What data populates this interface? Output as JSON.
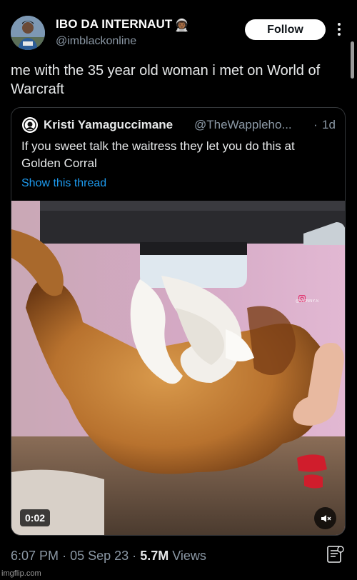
{
  "author": {
    "display_name": "IBO DA INTERNAUT",
    "badge_emoji": "👨🏾‍🚀",
    "handle": "@imblackonline",
    "avatar_icon": "avatar-photo"
  },
  "header": {
    "follow_label": "Follow",
    "more_icon": "more-vertical-icon"
  },
  "tweet": {
    "text": "me with the 35 year old woman i met on World of Warcraft"
  },
  "quote": {
    "name": "Kristi Yamaguccimane",
    "handle": "@TheWappleho...",
    "separator": "·",
    "time": "1d",
    "text": "If you sweet talk the waitress they let you do this at Golden Corral",
    "show_thread": "Show this thread"
  },
  "media": {
    "duration": "0:02",
    "watermark": "@VONNY.S",
    "mute_icon": "volume-mute-icon"
  },
  "meta": {
    "time": "6:07 PM",
    "date": "05 Sep 23",
    "views_count": "5.7M",
    "views_label": "Views",
    "sep": "·"
  },
  "footer": {
    "watermark": "imgflip.com"
  },
  "colors": {
    "background": "#000000",
    "link": "#1d9bf0",
    "muted": "#8b98a5",
    "text": "#e7e9ea"
  }
}
